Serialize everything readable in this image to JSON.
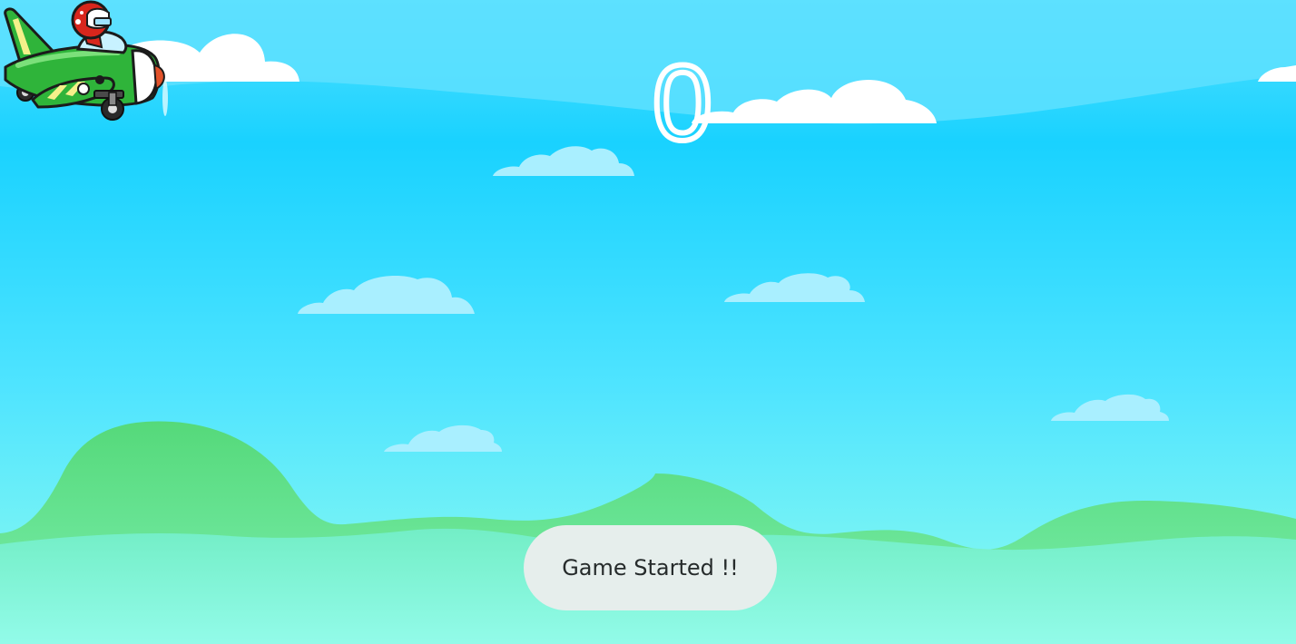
{
  "game": {
    "score": "0",
    "toast": "Game Started !!"
  },
  "colors": {
    "sky_top": "#3fd9ff",
    "sky_mid": "#1ad3ff",
    "sky_bottom": "#8ffff2",
    "hill_back": "#62dd82",
    "hill_front": "#8af6d6",
    "cloud": "#ffffff",
    "cloud_far": "#a7efff",
    "plane_body": "#2fb43a",
    "plane_stripe": "#f5f08a",
    "pilot_helmet": "#d8261c",
    "toast_bg": "#e6eeec"
  }
}
